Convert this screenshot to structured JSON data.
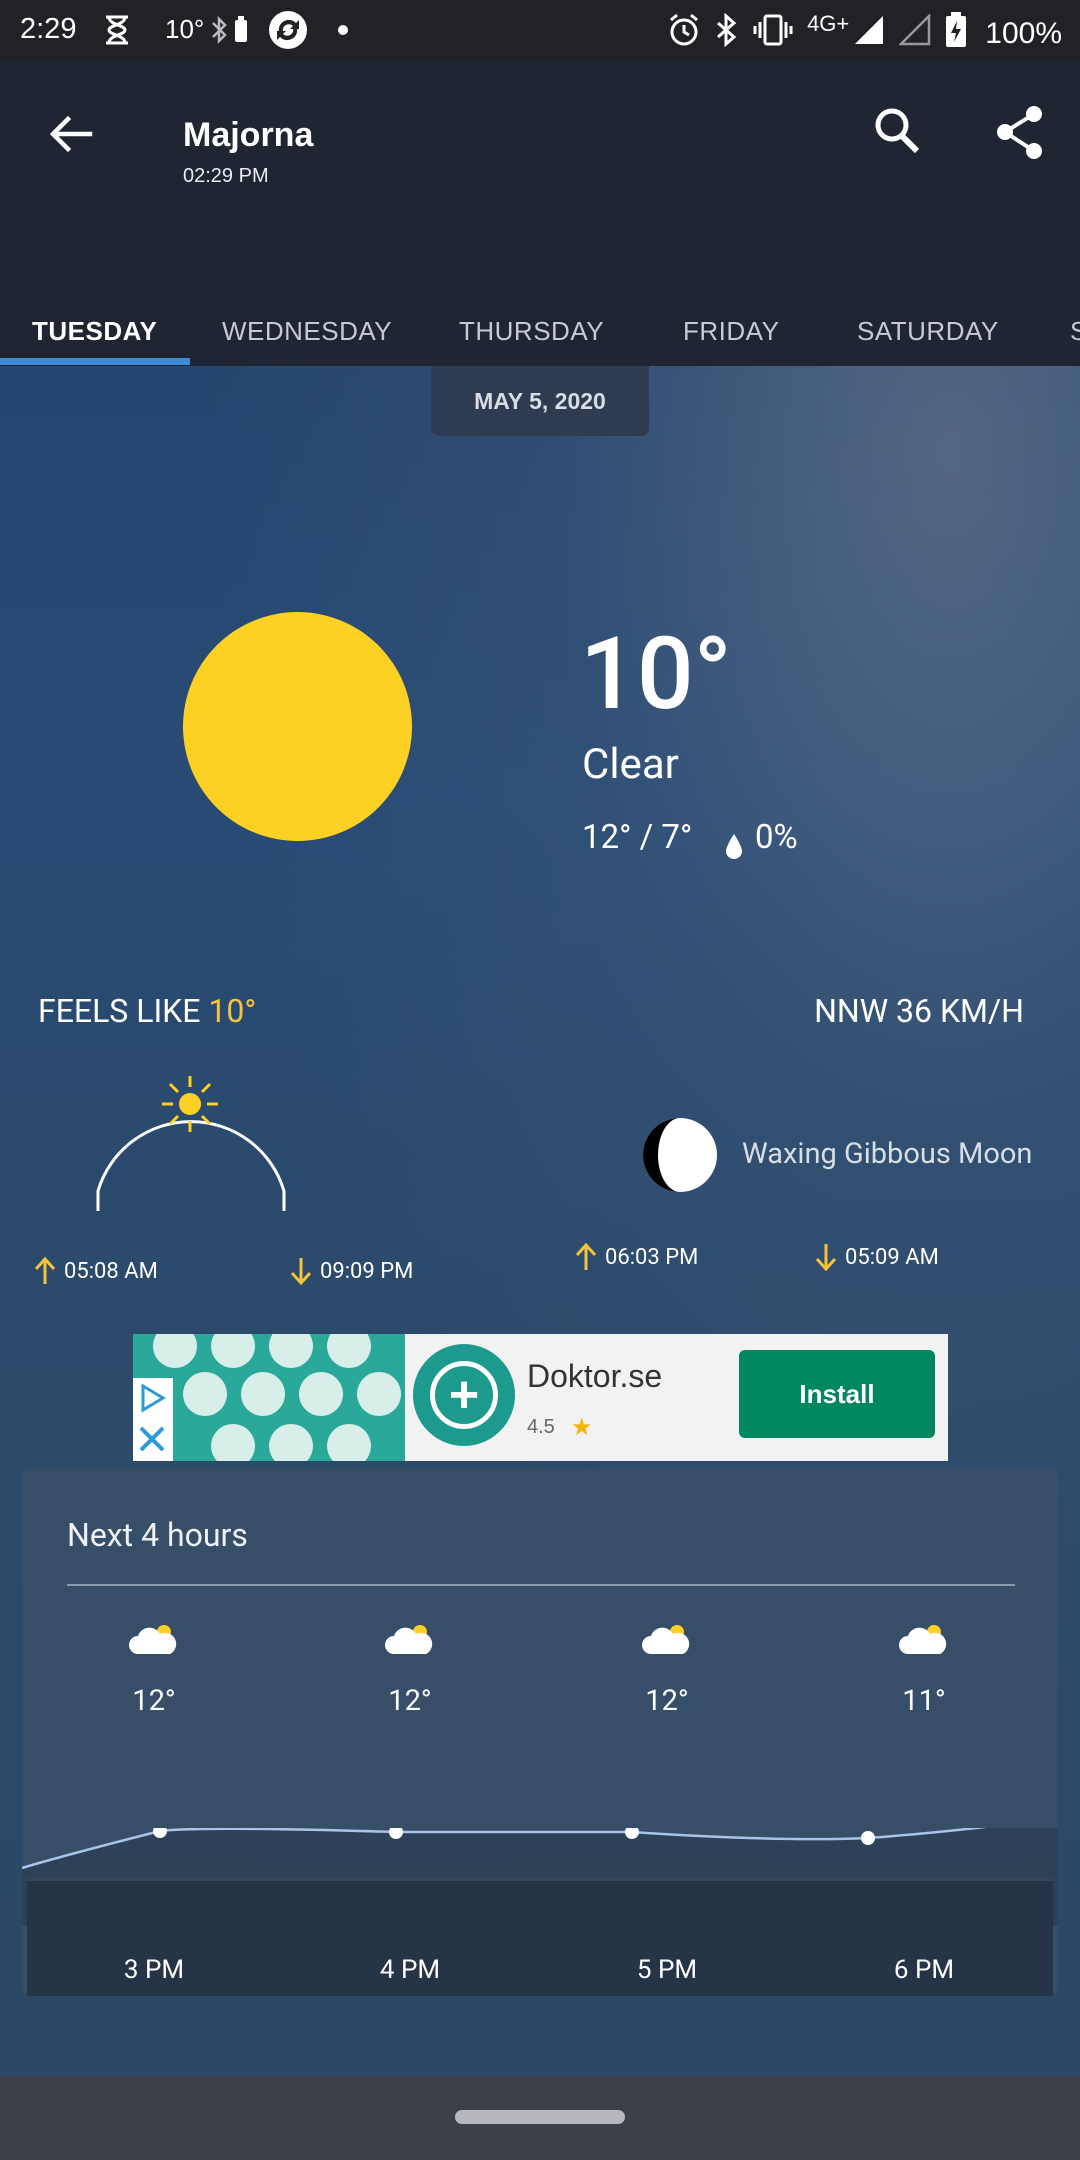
{
  "status_bar": {
    "time": "2:29",
    "temperature": "10°",
    "network": "4G+",
    "battery": "100%"
  },
  "header": {
    "location": "Majorna",
    "time": "02:29 PM"
  },
  "tabs": [
    "TUESDAY",
    "WEDNESDAY",
    "THURSDAY",
    "FRIDAY",
    "SATURDAY",
    "S"
  ],
  "active_tab": "TUESDAY",
  "date": "MAY 5, 2020",
  "current": {
    "icon": "sun-icon",
    "temperature": "10°",
    "condition": "Clear",
    "hi_lo": "12° / 7°",
    "precipitation": "0%",
    "feels_like_label": "FEELS LIKE",
    "feels_like_value": "10°",
    "wind": "NNW 36 KM/H"
  },
  "sun": {
    "sunrise": "05:08 AM",
    "sunset": "09:09 PM"
  },
  "moon": {
    "phase": "Waxing Gibbous Moon",
    "moonrise": "06:03 PM",
    "moonset": "05:09 AM"
  },
  "ad": {
    "app_name": "Doktor.se",
    "rating": "4.5",
    "install_label": "Install"
  },
  "hourly": {
    "title": "Next 4 hours",
    "items": [
      {
        "time": "3 PM",
        "temp": "12°",
        "icon": "partly-cloudy-icon"
      },
      {
        "time": "4 PM",
        "temp": "12°",
        "icon": "partly-cloudy-icon"
      },
      {
        "time": "5 PM",
        "temp": "12°",
        "icon": "partly-cloudy-icon"
      },
      {
        "time": "6 PM",
        "temp": "11°",
        "icon": "partly-cloudy-icon"
      }
    ]
  },
  "colors": {
    "sun": "#fdd024",
    "accent": "#f5c33a",
    "tab_indicator": "#3b8bd9",
    "install": "#01875f"
  }
}
